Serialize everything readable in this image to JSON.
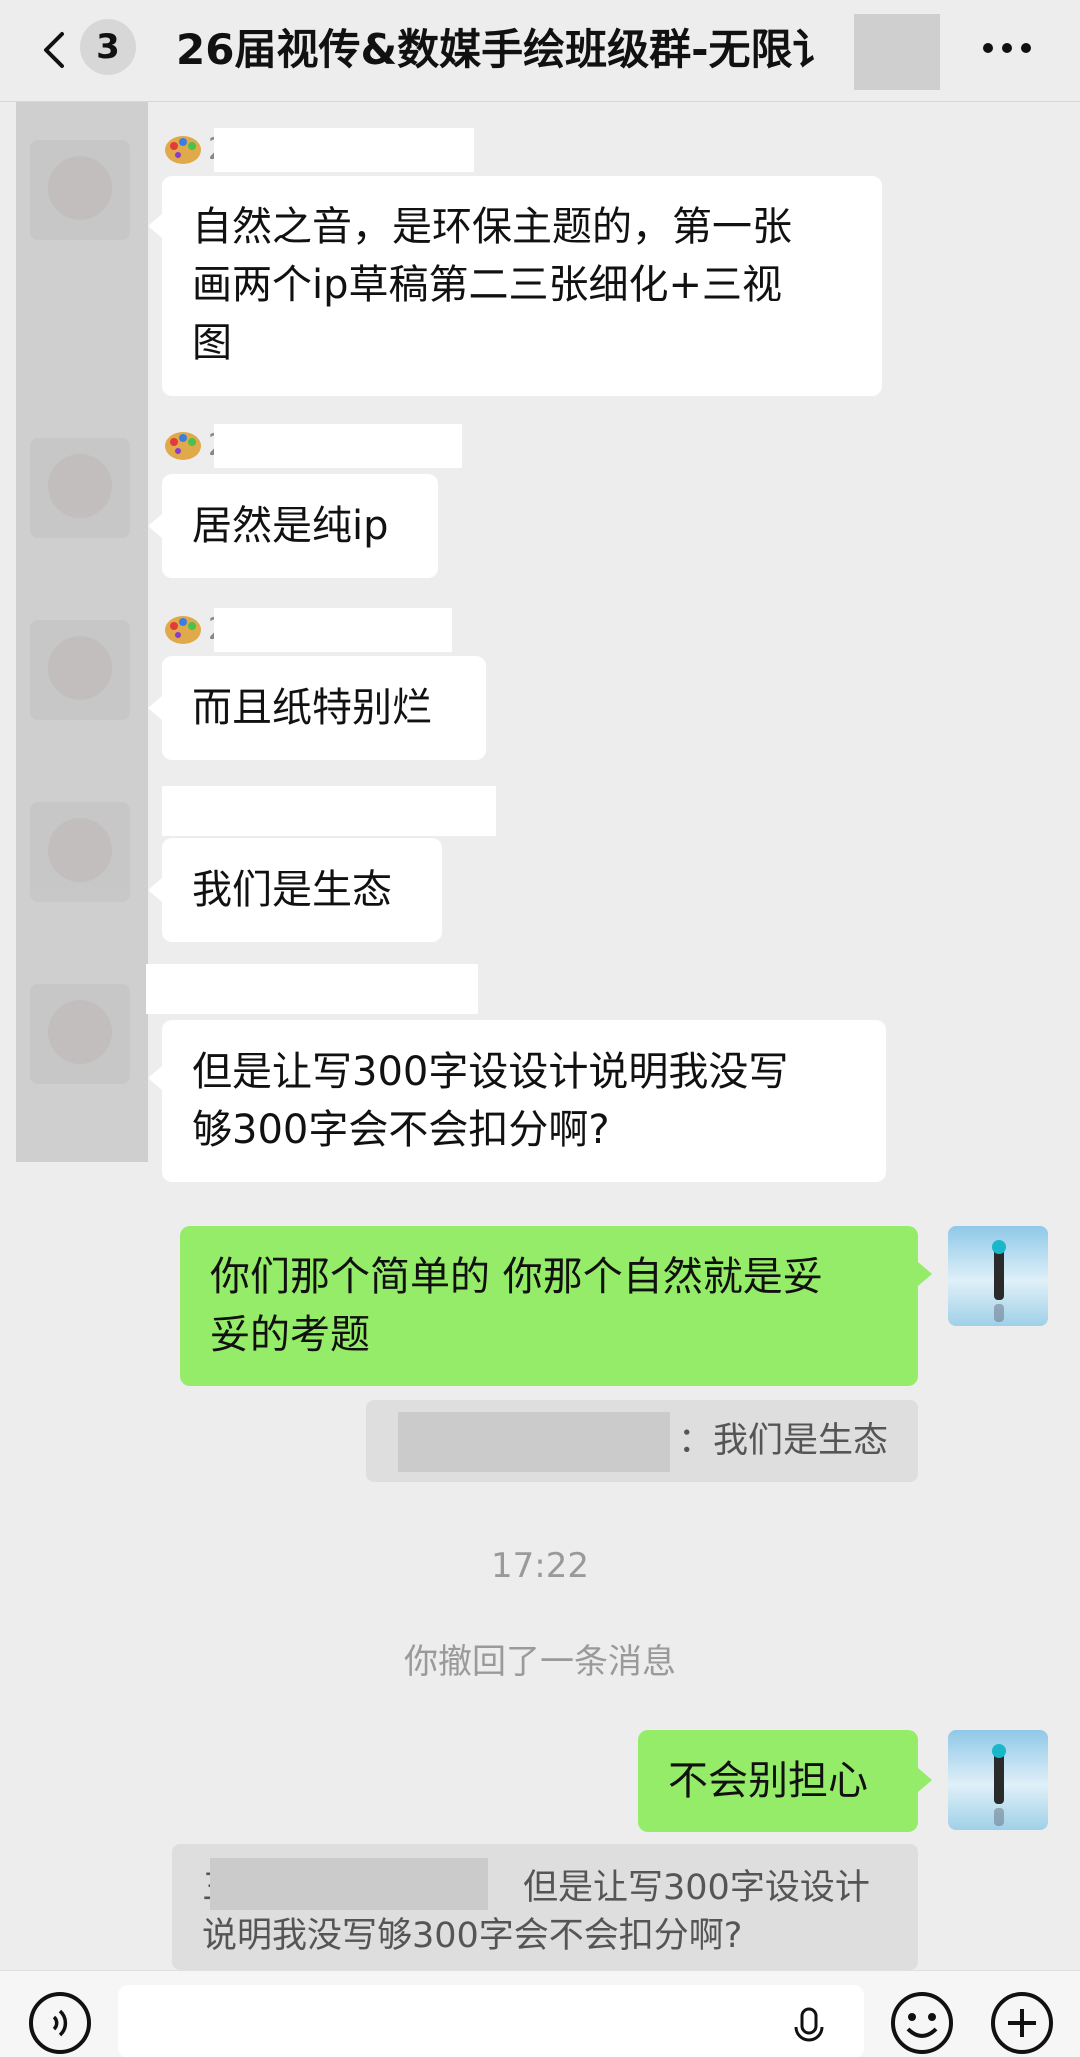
{
  "header": {
    "back_label": "‹",
    "unread_count": "3",
    "title": "26届视传&数媒手绘班级群-无限讠"
  },
  "messages": [
    {
      "name_visible": "2",
      "text_lines": [
        "自然之音，是环保主题的，第一张",
        "画两个ip草稿第二三张细化+三视",
        "图"
      ]
    },
    {
      "name_visible": "2",
      "text_lines": [
        "居然是纯ip"
      ]
    },
    {
      "name_visible": "2",
      "text_lines": [
        "而且纸特别烂"
      ]
    },
    {
      "name_visible": "",
      "text_lines": [
        "我们是生态"
      ]
    },
    {
      "name_visible": "",
      "text_lines": [
        "但是让写300字设设计说明我没写",
        "够300字会不会扣分啊?"
      ]
    }
  ],
  "my_messages": [
    {
      "text_lines": [
        "你们那个简单的  你那个自然就是妥",
        "妥的考题"
      ],
      "quote": "：我们是生态"
    },
    {
      "text_lines": [
        "不会别担心"
      ],
      "quote_lines": [
        "但是让写300字设设计",
        "说明我没写够300字会不会扣分啊?"
      ],
      "quote_prefix": "三"
    }
  ],
  "timestamp": "17:22",
  "system_notice": "你撤回了一条消息",
  "colors": {
    "background": "#ededed",
    "my_bubble": "#95ec69",
    "their_bubble": "#ffffff"
  },
  "icons": [
    "back-icon",
    "more-icon",
    "palette-icon",
    "voice-icon",
    "mic-icon",
    "emoji-icon",
    "plus-icon"
  ]
}
